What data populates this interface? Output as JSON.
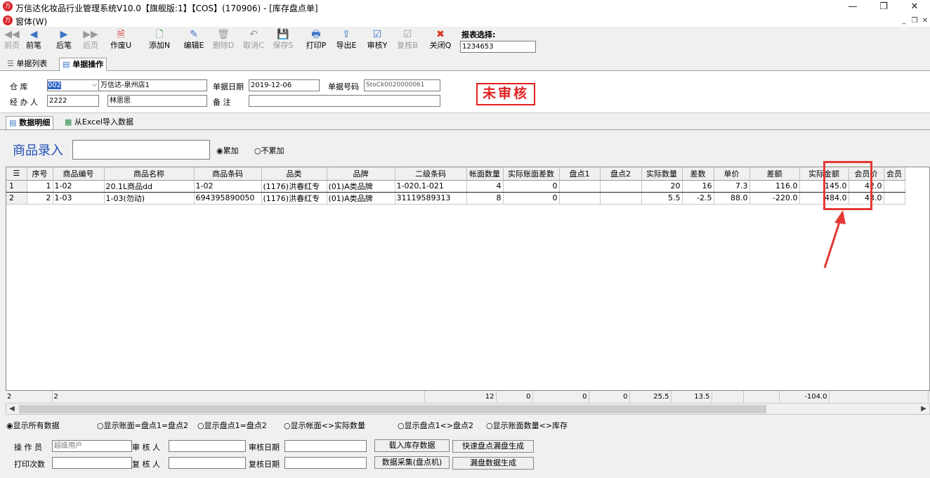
{
  "window": {
    "title": "万信达化妆品行业管理系统V10.0【旗舰版:1】【COS】(170906) - [库存盘点单]",
    "menu_item": "窗体(W)",
    "minimize": "—",
    "restore": "❐",
    "close": "✕"
  },
  "toolbar": {
    "buttons": [
      {
        "label": "前页",
        "icon": "◀◀"
      },
      {
        "label": "前笔",
        "icon": "◀"
      },
      {
        "label": "后笔",
        "icon": "▶"
      },
      {
        "label": "后页",
        "icon": "▶▶"
      },
      {
        "label": "作废U",
        "icon": "🗎"
      },
      {
        "label": "添加N",
        "icon": "🗋"
      },
      {
        "label": "编辑E",
        "icon": "✎"
      },
      {
        "label": "删除D",
        "icon": "🗑"
      },
      {
        "label": "取消C",
        "icon": "↶"
      },
      {
        "label": "保存S",
        "icon": "💾"
      },
      {
        "label": "打印P",
        "icon": "🖶"
      },
      {
        "label": "导出E",
        "icon": "⇪"
      },
      {
        "label": "审核Y",
        "icon": "☑"
      },
      {
        "label": "复核B",
        "icon": "☑"
      },
      {
        "label": "关闭Q",
        "icon": "✖"
      }
    ],
    "report_label": "报表选择:",
    "report_value": "1234653"
  },
  "tabs_top": {
    "list": "单据列表",
    "operation": "单据操作"
  },
  "header": {
    "warehouse_label": "仓    库",
    "warehouse_code": "002",
    "warehouse_name": "万信达-泉州店1",
    "operator_label": "经 办 人",
    "operator_code": "2222",
    "operator_name": "林思思",
    "date_label": "单据日期",
    "date_value": "2019-12-06",
    "remark_label": "备    注",
    "remark_value": "",
    "docno_label": "单据号码",
    "docno_value": "StoCk0020000061",
    "status": "未审核"
  },
  "tabs_detail": {
    "detail": "数据明细",
    "excel": "从Excel导入数据"
  },
  "entry": {
    "label": "商品录入",
    "value": "",
    "opt_accumulate": "累加",
    "opt_no_accumulate": "不累加"
  },
  "grid": {
    "columns": [
      "序号",
      "商品编号",
      "商品名称",
      "商品条码",
      "品类",
      "品牌",
      "二级条码",
      "帐面数量",
      "实际账面差数",
      "盘点1",
      "盘点2",
      "实际数量",
      "差数",
      "单价",
      "差额",
      "实际金额",
      "会员价",
      "会员"
    ],
    "rows": [
      {
        "rownum": "1",
        "cells": [
          "1",
          "1-02",
          "20.1L商品dd",
          "1-02",
          "(1176)洪春红专",
          "(01)A类品牌",
          "1-020,1-021",
          "4",
          "0",
          "",
          "",
          "20",
          "16",
          "7.3",
          "116.0",
          "145.0",
          "42.0",
          ""
        ]
      },
      {
        "rownum": "2",
        "cells": [
          "2",
          "1-03",
          "1-03(勿动)",
          "694395890050",
          "(1176)洪春红专",
          "(01)A类品牌",
          "31119589313",
          "8",
          "0",
          "",
          "",
          "5.5",
          "-2.5",
          "88.0",
          "-220.0",
          "484.0",
          "43.0",
          ""
        ]
      }
    ],
    "footer": {
      "rowcount": "2",
      "seq": "2",
      "book_qty": "12",
      "book_diff": "0",
      "count1": "0",
      "count2": "0",
      "actual_qty": "25.5",
      "diff": "13.5",
      "diff_amount": "-104.0"
    }
  },
  "filters": {
    "all": "显示所有数据",
    "opt1": "显示账面=盘点1=盘点2",
    "opt2": "显示盘点1=盘点2",
    "opt3": "显示帐面<>实际数量",
    "opt4": "显示盘点1<>盘点2",
    "opt5": "显示账面数量<>库存"
  },
  "bottom": {
    "operator_label": "操 作 员",
    "operator_value": "超级用户",
    "auditor_label": "审 核 人",
    "auditor_value": "",
    "audit_date_label": "审核日期",
    "audit_date_value": "",
    "print_count_label": "打印次数",
    "print_count_value": "",
    "reviewer_label": "复 核 人",
    "reviewer_value": "",
    "review_date_label": "复核日期",
    "review_date_value": "",
    "load_stock_button": "载入库存数据",
    "quick_missing_button": "快速盘点漏盘生成",
    "collect_button": "数据采集(盘点机)",
    "missing_button": "漏盘数据生成"
  },
  "colors": {
    "highlight": "#e53935",
    "title_blue": "#1f4fb5"
  }
}
